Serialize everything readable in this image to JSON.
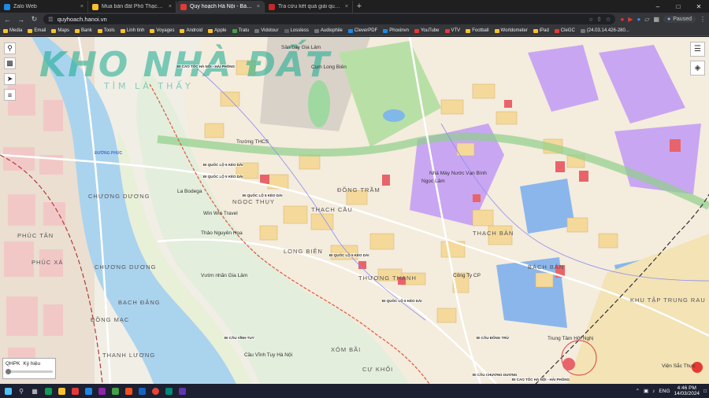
{
  "browser": {
    "tabs": [
      {
        "title": "Zalo Web",
        "color": "#1e88e5",
        "active": false
      },
      {
        "title": "Mua bán đất Phố Thạch Cầu, Gia...",
        "color": "#fbc02d",
        "active": false
      },
      {
        "title": "Quy hoạch Hà Nội - Bản đồ",
        "color": "#e53935",
        "active": true
      },
      {
        "title": "Tra cứu kết quả giải quyết TTHC",
        "color": "#c62828",
        "active": false
      }
    ],
    "close_glyph": "×",
    "new_tab_glyph": "+",
    "url": "quyhoach.hanoi.vn",
    "profile_label": "Paused",
    "bookmarks": [
      {
        "label": "Media",
        "color": "#fbc02d"
      },
      {
        "label": "Email",
        "color": "#fbc02d"
      },
      {
        "label": "Maps",
        "color": "#fbc02d"
      },
      {
        "label": "Bank",
        "color": "#fbc02d"
      },
      {
        "label": "Tools",
        "color": "#fbc02d"
      },
      {
        "label": "Linh tinh",
        "color": "#fbc02d"
      },
      {
        "label": "Voyages",
        "color": "#fbc02d"
      },
      {
        "label": "Android",
        "color": "#fbc02d"
      },
      {
        "label": "Apple",
        "color": "#fbc02d"
      },
      {
        "label": "Tratu",
        "color": "#43a047"
      },
      {
        "label": "Vidotour",
        "color": "#757575"
      },
      {
        "label": "Lossless",
        "color": "#616161"
      },
      {
        "label": "Audiophile",
        "color": "#757575"
      },
      {
        "label": "CleverPDF",
        "color": "#1e88e5"
      },
      {
        "label": "Phoxinvn",
        "color": "#1e88e5"
      },
      {
        "label": "YouTube",
        "color": "#e53935"
      },
      {
        "label": "VTV",
        "color": "#e53935"
      },
      {
        "label": "Football",
        "color": "#fbc02d"
      },
      {
        "label": "Worldometer",
        "color": "#fbc02d"
      },
      {
        "label": "iPad",
        "color": "#fbc02d"
      },
      {
        "label": "CleGC",
        "color": "#e53935"
      },
      {
        "label": "(24.03.14.426-280...",
        "color": "#757575"
      }
    ]
  },
  "map": {
    "watermark_main": "KHO NHÀ ĐẤT",
    "watermark_sub": "TÌM LÀ THẤY",
    "legend": {
      "label_left": "QHPK",
      "label_right": "Ký hiệu"
    },
    "areas": [
      {
        "text": "Sân bay Gia Lâm",
        "style": "poi"
      },
      {
        "text": "Cụm Long Biên",
        "style": "poi"
      },
      {
        "text": "CHƯƠNG DƯƠNG",
        "style": "big"
      },
      {
        "text": "PHÚC TÂN",
        "style": "big"
      },
      {
        "text": "PHÚC XÁ",
        "style": "big"
      },
      {
        "text": "CHƯƠNG DƯƠNG",
        "style": "big"
      },
      {
        "text": "BẠCH ĐẰNG",
        "style": "big"
      },
      {
        "text": "THANH LƯƠNG",
        "style": "big"
      },
      {
        "text": "ĐỒNG MẠC",
        "style": "big"
      },
      {
        "text": "NGỌC THỤY",
        "style": "big"
      },
      {
        "text": "ĐỒNG TRẦM",
        "style": "big"
      },
      {
        "text": "THẠCH CẦU",
        "style": "big"
      },
      {
        "text": "LONG BIÊN",
        "style": "big"
      },
      {
        "text": "THƯỢNG THANH",
        "style": "big"
      },
      {
        "text": "BÁCH BÂN",
        "style": "big"
      },
      {
        "text": "THẠCH BÀN",
        "style": "big"
      },
      {
        "text": "XÓM BÃI",
        "style": "big"
      },
      {
        "text": "CỰ KHỐI",
        "style": "big"
      },
      {
        "text": "KHU TẬP TRUNG RAU",
        "style": "big"
      },
      {
        "text": "Thảo Nguyên Hoa",
        "style": "poi"
      },
      {
        "text": "Vườn nhãn Gia Lâm",
        "style": "poi"
      },
      {
        "text": "Cầu Vĩnh Tuy Hà Nội",
        "style": "poi"
      },
      {
        "text": "Win Win Travel",
        "style": "poi"
      },
      {
        "text": "La Bodega",
        "style": "poi"
      },
      {
        "text": "Nhà Máy Nước Vạn Bình",
        "style": "poi"
      },
      {
        "text": "Trung Tâm Hội Nghị",
        "style": "poi"
      },
      {
        "text": "Trường THCS",
        "style": "poi"
      },
      {
        "text": "Công Ty CP",
        "style": "poi"
      },
      {
        "text": "Ngọc Lâm",
        "style": "poi"
      },
      {
        "text": "Viện Sắc Thực",
        "style": "poi"
      },
      {
        "text": "ĐƯỜNG PHÚC",
        "style": "ac"
      }
    ],
    "roads": [
      "ĐI QUỐC LỘ 5 KÉO DÀI",
      "ĐI QUỐC LỘ 5 KÉO DÀI",
      "ĐI QUỐC LỘ 5 KÉO DÀI",
      "ĐI QUỐC LỘ 5 KÉO DÀI",
      "ĐI QUỐC LỘ 5 KÉO DÀI",
      "ĐI CẦU CHƯƠNG DƯƠNG",
      "ĐI CẦU VĨNH TUY",
      "ĐI CAO TỐC HÀ NỘI - HẢI PHÒNG",
      "ĐI CẦU ĐÔNG TRÙ",
      "ĐI CAO TỐC HÀ NỘI - HẢI PHÒNG"
    ]
  },
  "taskbar": {
    "language": "ENG",
    "time": "4:46 PM",
    "date": "14/03/2024"
  }
}
